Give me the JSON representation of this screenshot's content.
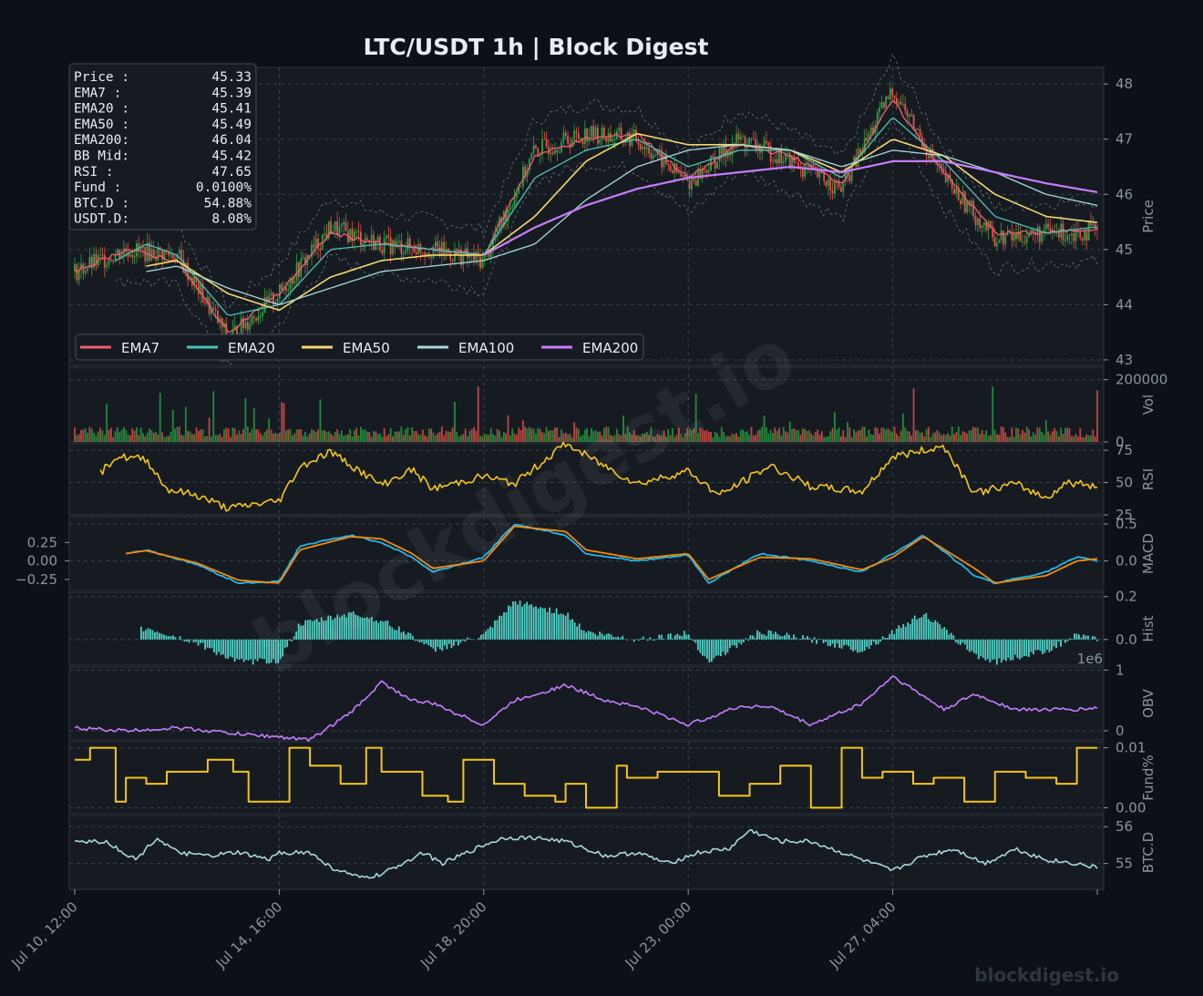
{
  "title": "LTC/USDT  1h  |  Block Digest",
  "watermark": "blockdigest.io",
  "footer_brand": "blockdigest.io",
  "colors": {
    "background": "#0d1117",
    "panel": "#161b22",
    "grid": "#3a414a",
    "up": "#26a641",
    "down": "#e5534b",
    "ema7": "#f0616d",
    "ema20": "#4fc1b4",
    "ema50": "#f5d76e",
    "ema100": "#a8d8d8",
    "ema200": "#c77dff",
    "rsi": "#f5c518",
    "macd": "#1fb8f0",
    "signal": "#f58a07",
    "hist": "#4fd1c5",
    "obv": "#c77dff",
    "fund": "#f5c518",
    "btcd": "#a8d8d8",
    "text": "#e6edf3",
    "muted": "#8b949e"
  },
  "info_box": [
    {
      "label": "Price :",
      "value": "45.33"
    },
    {
      "label": "EMA7  :",
      "value": "45.39"
    },
    {
      "label": "EMA20 :",
      "value": "45.41"
    },
    {
      "label": "EMA50 :",
      "value": "45.49"
    },
    {
      "label": "EMA200:",
      "value": "46.04"
    },
    {
      "label": "BB Mid:",
      "value": "45.42"
    },
    {
      "label": "RSI   :",
      "value": "47.65"
    },
    {
      "label": "Fund  :",
      "value": "0.0100%"
    },
    {
      "label": "BTC.D :",
      "value": "54.88%"
    },
    {
      "label": "USDT.D:",
      "value": "8.08%"
    }
  ],
  "legend": [
    {
      "name": "EMA7",
      "color": "#f0616d"
    },
    {
      "name": "EMA20",
      "color": "#4fc1b4"
    },
    {
      "name": "EMA50",
      "color": "#f5d76e"
    },
    {
      "name": "EMA100",
      "color": "#a8d8d8"
    },
    {
      "name": "EMA200",
      "color": "#c77dff"
    }
  ],
  "x_ticks": [
    "Jul 10, 12:00",
    "Jul 14, 16:00",
    "Jul 18, 20:00",
    "Jul 23, 00:00",
    "Jul 27, 04:00"
  ],
  "chart_data": {
    "type": "line",
    "x_range": [
      "Jul 10, 12:00",
      "Jul 30, 20:00"
    ],
    "panels": [
      {
        "name": "Price",
        "ylabel": "Price",
        "ylim": [
          42.9,
          48.3
        ],
        "ticks": [
          "43",
          "44",
          "45",
          "46",
          "47",
          "48"
        ],
        "tick_values": [
          43,
          44,
          45,
          46,
          47,
          48
        ],
        "series": [
          {
            "name": "Price",
            "type": "candlestick",
            "x": [
              0,
              0.05,
              0.1,
              0.15,
              0.2,
              0.25,
              0.3,
              0.35,
              0.4,
              0.45,
              0.5,
              0.55,
              0.6,
              0.65,
              0.7,
              0.75,
              0.8,
              0.85,
              0.9,
              0.95,
              1
            ],
            "values": [
              44.6,
              45.0,
              44.9,
              43.4,
              44.2,
              45.4,
              45.1,
              45.0,
              44.8,
              46.8,
              47.1,
              47.0,
              46.2,
              47.0,
              46.6,
              46.1,
              47.9,
              46.3,
              45.2,
              45.3,
              45.33
            ]
          },
          {
            "name": "EMA7",
            "x": [
              0,
              0.05,
              0.1,
              0.15,
              0.2,
              0.25,
              0.3,
              0.35,
              0.4,
              0.45,
              0.5,
              0.55,
              0.6,
              0.65,
              0.7,
              0.75,
              0.8,
              0.85,
              0.9,
              0.95,
              1
            ],
            "values": [
              44.6,
              45.0,
              44.8,
              43.5,
              44.2,
              45.3,
              45.1,
              45.0,
              44.9,
              46.7,
              47.0,
              47.1,
              46.3,
              46.9,
              46.7,
              46.2,
              47.7,
              46.4,
              45.3,
              45.3,
              45.39
            ]
          },
          {
            "name": "EMA20",
            "x": [
              0.04,
              0.07,
              0.1,
              0.15,
              0.2,
              0.25,
              0.3,
              0.35,
              0.4,
              0.45,
              0.5,
              0.55,
              0.6,
              0.65,
              0.7,
              0.75,
              0.8,
              0.85,
              0.9,
              0.95,
              1
            ],
            "values": [
              44.8,
              45.1,
              44.9,
              43.8,
              44.0,
              45.0,
              45.1,
              45.0,
              44.9,
              46.3,
              46.8,
              47.0,
              46.5,
              46.8,
              46.8,
              46.3,
              47.4,
              46.6,
              45.6,
              45.3,
              45.41
            ]
          },
          {
            "name": "EMA50",
            "x": [
              0.07,
              0.1,
              0.15,
              0.2,
              0.25,
              0.3,
              0.35,
              0.4,
              0.45,
              0.5,
              0.55,
              0.6,
              0.65,
              0.7,
              0.75,
              0.8,
              0.85,
              0.9,
              0.95,
              1
            ],
            "values": [
              44.7,
              44.8,
              44.2,
              43.9,
              44.5,
              44.8,
              44.9,
              44.9,
              45.6,
              46.6,
              47.1,
              46.9,
              46.9,
              46.8,
              46.4,
              47.0,
              46.7,
              46.0,
              45.6,
              45.49
            ]
          },
          {
            "name": "EMA100",
            "x": [
              0.07,
              0.1,
              0.15,
              0.2,
              0.25,
              0.3,
              0.35,
              0.4,
              0.45,
              0.5,
              0.55,
              0.6,
              0.65,
              0.7,
              0.75,
              0.8,
              0.85,
              0.9,
              0.95,
              1
            ],
            "values": [
              44.6,
              44.7,
              44.3,
              44.0,
              44.3,
              44.6,
              44.7,
              44.8,
              45.1,
              45.9,
              46.5,
              46.8,
              46.9,
              46.8,
              46.5,
              46.8,
              46.7,
              46.4,
              46.0,
              45.8
            ]
          },
          {
            "name": "EMA200",
            "x": [
              0.4,
              0.45,
              0.5,
              0.55,
              0.6,
              0.65,
              0.7,
              0.75,
              0.8,
              0.85,
              0.9,
              0.95,
              1
            ],
            "values": [
              44.9,
              45.4,
              45.8,
              46.1,
              46.3,
              46.4,
              46.5,
              46.4,
              46.6,
              46.6,
              46.4,
              46.2,
              46.04
            ]
          }
        ]
      },
      {
        "name": "Vol",
        "ylabel": "Vol",
        "ylim": [
          0,
          240000
        ],
        "ticks": [
          "0",
          "200000"
        ],
        "tick_values": [
          0,
          200000
        ],
        "type": "bar",
        "values_note": "hourly volume bars, typically 20000-60000 with spikes to ~200000"
      },
      {
        "name": "RSI",
        "ylabel": "RSI",
        "ylim": [
          25,
          80
        ],
        "ticks": [
          "25",
          "50",
          "75"
        ],
        "tick_values": [
          25,
          50,
          75
        ],
        "series": [
          {
            "name": "RSI",
            "x": [
              0.025,
              0.04,
              0.07,
              0.09,
              0.12,
              0.15,
              0.2,
              0.22,
              0.25,
              0.3,
              0.33,
              0.35,
              0.4,
              0.43,
              0.48,
              0.52,
              0.55,
              0.6,
              0.63,
              0.68,
              0.72,
              0.77,
              0.8,
              0.85,
              0.88,
              0.92,
              0.95,
              0.97,
              1
            ],
            "values": [
              57,
              70,
              68,
              45,
              40,
              30,
              36,
              62,
              74,
              48,
              60,
              45,
              55,
              49,
              80,
              62,
              49,
              59,
              40,
              63,
              47,
              43,
              70,
              78,
              42,
              49,
              38,
              50,
              47.65
            ]
          }
        ]
      },
      {
        "name": "MACD",
        "ylabel": "MACD",
        "ylim": [
          -0.4,
          0.6
        ],
        "ticks_left": [
          "0.25",
          "0.00",
          "−0.25"
        ],
        "ticks_right": [
          "0.0",
          "0.5"
        ],
        "tick_values_left": [
          0.25,
          0,
          -0.25
        ],
        "tick_values_right": [
          0,
          0.5
        ],
        "series": [
          {
            "name": "MACD",
            "x": [
              0.05,
              0.07,
              0.12,
              0.16,
              0.2,
              0.22,
              0.27,
              0.3,
              0.33,
              0.35,
              0.4,
              0.43,
              0.48,
              0.5,
              0.55,
              0.6,
              0.62,
              0.67,
              0.72,
              0.77,
              0.8,
              0.83,
              0.88,
              0.9,
              0.95,
              0.98,
              1
            ],
            "values": [
              0.1,
              0.15,
              -0.05,
              -0.3,
              -0.28,
              0.2,
              0.35,
              0.25,
              0.05,
              -0.15,
              0.05,
              0.5,
              0.35,
              0.1,
              0.0,
              0.08,
              -0.3,
              0.1,
              0.0,
              -0.15,
              0.1,
              0.35,
              -0.2,
              -0.3,
              -0.15,
              0.05,
              0.0
            ]
          },
          {
            "name": "Signal",
            "x": [
              0.05,
              0.07,
              0.12,
              0.16,
              0.2,
              0.22,
              0.27,
              0.3,
              0.33,
              0.35,
              0.4,
              0.43,
              0.48,
              0.5,
              0.55,
              0.6,
              0.62,
              0.67,
              0.72,
              0.77,
              0.8,
              0.83,
              0.88,
              0.9,
              0.95,
              0.98,
              1
            ],
            "values": [
              0.1,
              0.14,
              -0.03,
              -0.26,
              -0.3,
              0.15,
              0.33,
              0.3,
              0.1,
              -0.1,
              0.0,
              0.47,
              0.4,
              0.15,
              0.03,
              0.1,
              -0.25,
              0.05,
              0.03,
              -0.12,
              0.05,
              0.33,
              -0.1,
              -0.3,
              -0.2,
              0.0,
              0.03
            ]
          }
        ]
      },
      {
        "name": "Hist",
        "ylabel": "Hist",
        "ylim": [
          -0.12,
          0.22
        ],
        "ticks": [
          "0.0",
          "0.2"
        ],
        "tick_values": [
          0,
          0.2
        ],
        "type": "bar"
      },
      {
        "name": "OBV",
        "ylabel": "OBV",
        "ylim": [
          -0.15,
          1.05
        ],
        "ticks": [
          "0",
          "1"
        ],
        "tick_values": [
          0,
          1
        ],
        "offset_label": "1e6",
        "series": [
          {
            "name": "OBV",
            "x": [
              0,
              0.05,
              0.1,
              0.13,
              0.16,
              0.2,
              0.23,
              0.27,
              0.3,
              0.33,
              0.35,
              0.4,
              0.43,
              0.48,
              0.52,
              0.55,
              0.6,
              0.65,
              0.68,
              0.72,
              0.77,
              0.8,
              0.85,
              0.88,
              0.92,
              0.95,
              0.98,
              1
            ],
            "values": [
              0.05,
              0.0,
              0.05,
              0.0,
              -0.05,
              -0.1,
              -0.15,
              0.3,
              0.8,
              0.5,
              0.45,
              0.1,
              0.5,
              0.75,
              0.5,
              0.4,
              0.1,
              0.4,
              0.4,
              0.1,
              0.45,
              0.9,
              0.35,
              0.6,
              0.35,
              0.35,
              0.35,
              0.38
            ]
          }
        ]
      },
      {
        "name": "Fund%",
        "ylabel": "Fund%",
        "ylim": [
          -0.001,
          0.011
        ],
        "ticks": [
          "0.00",
          "0.01"
        ],
        "tick_values": [
          0,
          0.01
        ],
        "type": "step",
        "series": [
          {
            "name": "Fund%",
            "x": [
              0,
              0.015,
              0.04,
              0.05,
              0.07,
              0.09,
              0.13,
              0.155,
              0.17,
              0.21,
              0.23,
              0.26,
              0.285,
              0.3,
              0.34,
              0.365,
              0.38,
              0.41,
              0.44,
              0.47,
              0.48,
              0.5,
              0.53,
              0.54,
              0.57,
              0.6,
              0.63,
              0.66,
              0.69,
              0.72,
              0.75,
              0.77,
              0.79,
              0.82,
              0.84,
              0.87,
              0.9,
              0.93,
              0.96,
              0.98,
              1
            ],
            "values": [
              0.008,
              0.01,
              0.001,
              0.005,
              0.004,
              0.006,
              0.008,
              0.006,
              0.001,
              0.01,
              0.007,
              0.004,
              0.01,
              0.006,
              0.002,
              0.001,
              0.008,
              0.004,
              0.002,
              0.001,
              0.004,
              0.0,
              0.007,
              0.005,
              0.006,
              0.006,
              0.002,
              0.004,
              0.007,
              0.0,
              0.01,
              0.005,
              0.006,
              0.004,
              0.005,
              0.001,
              0.006,
              0.005,
              0.004,
              0.01,
              0.01
            ]
          }
        ]
      },
      {
        "name": "BTC.D",
        "ylabel": "BTC.D",
        "ylim": [
          54.3,
          56.3
        ],
        "ticks": [
          "55",
          "56"
        ],
        "tick_values": [
          55,
          56
        ],
        "series": [
          {
            "name": "BTC.D",
            "x": [
              0,
              0.03,
              0.06,
              0.08,
              0.1,
              0.13,
              0.16,
              0.19,
              0.2,
              0.23,
              0.25,
              0.28,
              0.3,
              0.34,
              0.36,
              0.4,
              0.42,
              0.45,
              0.48,
              0.52,
              0.55,
              0.58,
              0.61,
              0.64,
              0.66,
              0.69,
              0.72,
              0.75,
              0.78,
              0.8,
              0.83,
              0.86,
              0.89,
              0.92,
              0.95,
              0.98,
              1
            ],
            "values": [
              55.6,
              55.6,
              55.1,
              55.7,
              55.3,
              55.2,
              55.3,
              55.1,
              55.3,
              55.3,
              54.9,
              54.6,
              54.7,
              55.3,
              55.0,
              55.5,
              55.7,
              55.7,
              55.6,
              55.2,
              55.3,
              55.0,
              55.3,
              55.4,
              55.9,
              55.6,
              55.6,
              55.3,
              55.0,
              54.8,
              55.2,
              55.4,
              55.0,
              55.4,
              55.1,
              55.0,
              54.88
            ]
          }
        ]
      }
    ]
  }
}
